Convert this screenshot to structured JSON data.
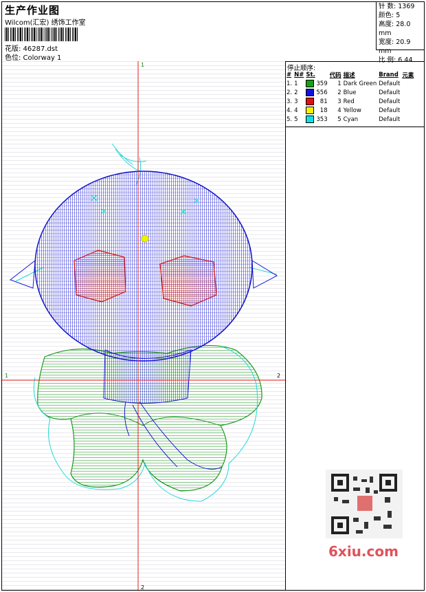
{
  "header": {
    "title": "生产作业图",
    "company": "Wilcom(汇宏) 绣饰工作室",
    "design_file": "花版: 46287.dst",
    "colorway": "色位: Colorway 1"
  },
  "stats": {
    "stitches": "针 数: 1369",
    "colors": "颜色: 5",
    "height": "高度: 28.0 mm",
    "width": "宽度: 20.9 mm",
    "ratio": "比 例: 6.44"
  },
  "stop_sequence": {
    "title": "停止顺序:",
    "columns": [
      "#",
      "N#",
      "St.",
      "代码",
      "描述",
      "Brand",
      "元素"
    ],
    "rows": [
      {
        "idx": "1.",
        "n": "1",
        "color": "#16a016",
        "st": "359",
        "code": "1",
        "desc": "Dark Green",
        "brand": "Default"
      },
      {
        "idx": "2.",
        "n": "2",
        "color": "#1010e0",
        "st": "556",
        "code": "2",
        "desc": "Blue",
        "brand": "Default"
      },
      {
        "idx": "3.",
        "n": "3",
        "color": "#e01010",
        "st": "81",
        "code": "3",
        "desc": "Red",
        "brand": "Default"
      },
      {
        "idx": "4.",
        "n": "4",
        "color": "#f2f200",
        "st": "18",
        "code": "4",
        "desc": "Yellow",
        "brand": "Default"
      },
      {
        "idx": "5.",
        "n": "5",
        "color": "#10e0e0",
        "st": "353",
        "code": "5",
        "desc": "Cyan",
        "brand": "Default"
      }
    ]
  },
  "axes": {
    "top": "1",
    "bottom": "2",
    "left": "1",
    "right": "2"
  },
  "watermark": {
    "text": "6xiu.com"
  }
}
